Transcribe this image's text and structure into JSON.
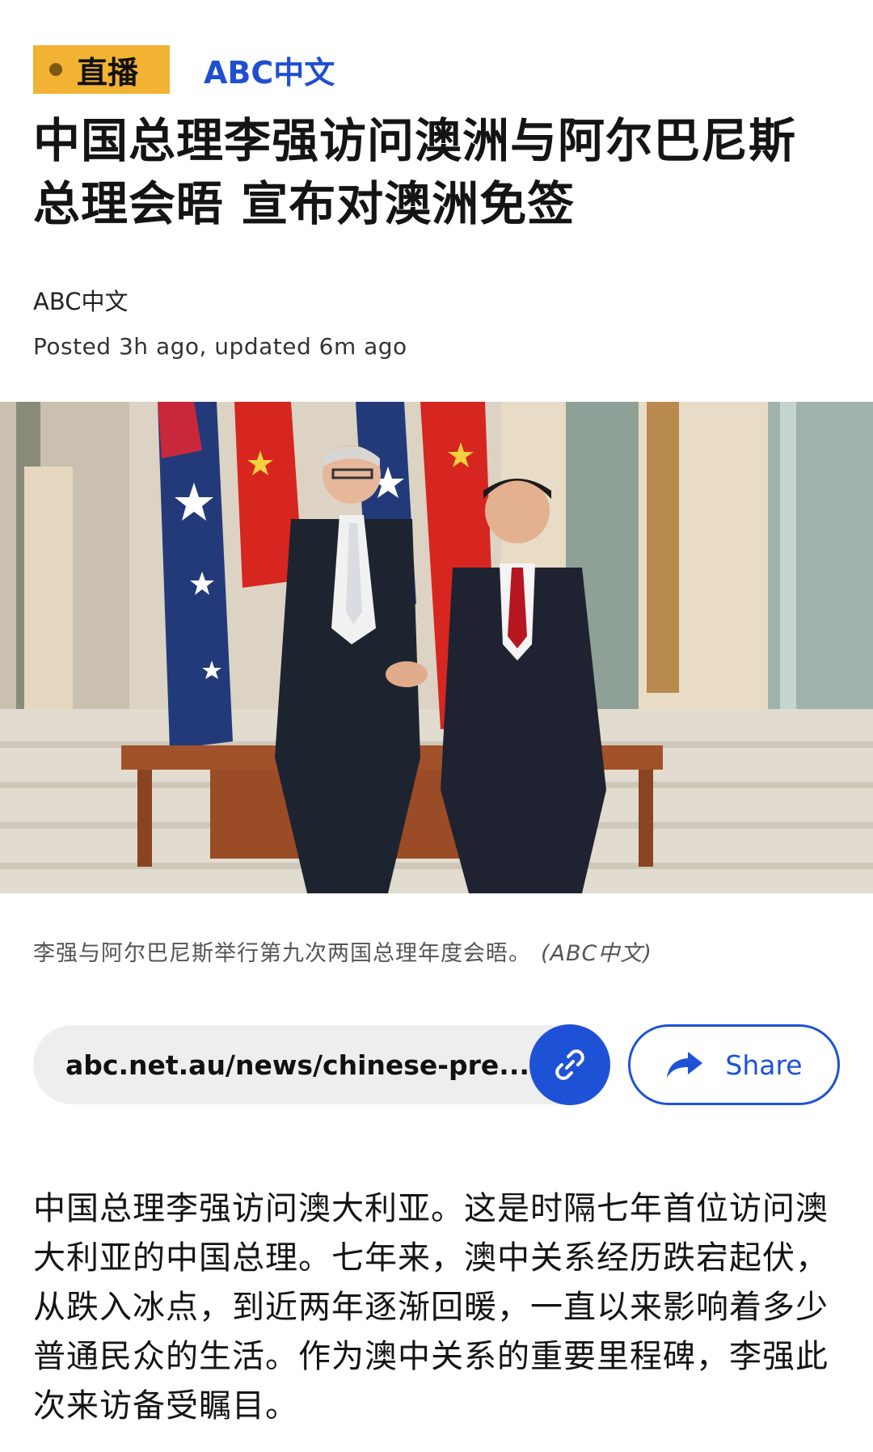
{
  "header": {
    "live_label": "直播",
    "source": "ABC中文"
  },
  "article": {
    "headline": "中国总理李强访问澳洲与阿尔巴尼斯总理会晤 宣布对澳洲免签",
    "byline": "ABC中文",
    "timestamp": "Posted 3h ago, updated 6m ago",
    "image_caption": "李强与阿尔巴尼斯举行第九次两国总理年度会晤。",
    "image_credit": "(ABC中文)",
    "body": "中国总理李强访问澳大利亚。这是时隔七年首位访问澳大利亚的中国总理。七年来，澳中关系经历跌宕起伏，从跌入冰点，到近两年逐渐回暖，一直以来影响着多少普通民众的生活。作为澳中关系的重要里程碑，李强此次来访备受瞩目。"
  },
  "share_bar": {
    "url": "abc.net.au/news/chinese-pre...",
    "share_label": "Share"
  },
  "icons": {
    "live": "live-dot-icon",
    "link": "link-icon",
    "share": "share-arrow-icon"
  },
  "colors": {
    "live_badge": "#f2b232",
    "accent_blue": "#1e52d6",
    "source_blue": "#1f4fd1",
    "url_bar_bg": "#eeeeee"
  }
}
